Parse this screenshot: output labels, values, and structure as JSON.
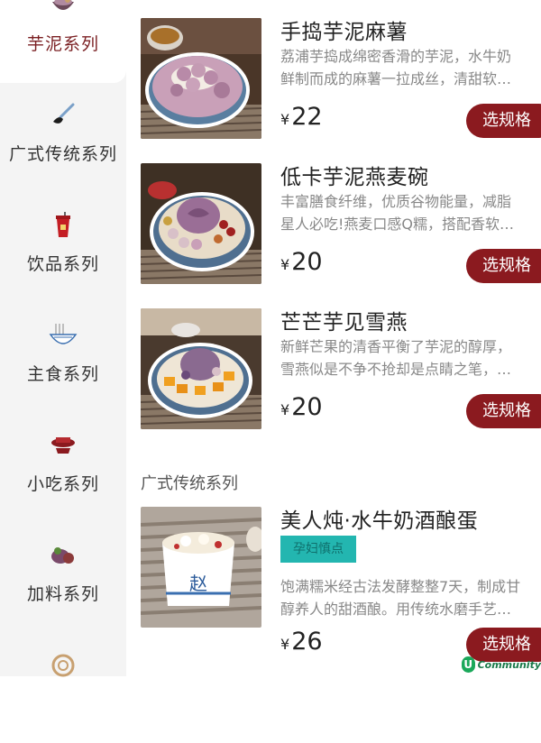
{
  "sidebar": {
    "items": [
      {
        "label": "芋泥系列",
        "icon": "taro-bowl-icon",
        "active": true
      },
      {
        "label": "广式传统系列",
        "icon": "spoon-icon",
        "active": false
      },
      {
        "label": "饮品系列",
        "icon": "drink-cup-icon",
        "active": false
      },
      {
        "label": "主食系列",
        "icon": "noodle-bowl-icon",
        "active": false
      },
      {
        "label": "小吃系列",
        "icon": "snack-dish-icon",
        "active": false
      },
      {
        "label": "加料系列",
        "icon": "topping-icon",
        "active": false
      },
      {
        "label": "",
        "icon": "pastry-icon",
        "active": false
      }
    ]
  },
  "sections": [
    {
      "title": "",
      "products": [
        {
          "name": "手捣芋泥麻薯",
          "desc_line1": "荔浦芋捣成绵密香滑的芋泥，水牛奶",
          "desc_line2": "鲜制而成的麻薯一拉成丝，清甜软…",
          "currency": "¥",
          "price": "22",
          "button": "选规格",
          "image": "taro-mochi-photo"
        },
        {
          "name": "低卡芋泥燕麦碗",
          "desc_line1": "丰富膳食纤维，优质谷物能量，减脂",
          "desc_line2": "星人必吃!燕麦口感Q糯，搭配香软…",
          "currency": "¥",
          "price": "20",
          "button": "选规格",
          "image": "taro-oat-bowl-photo"
        },
        {
          "name": "芒芒芋见雪燕",
          "desc_line1": "新鲜芒果的清香平衡了芋泥的醇厚，",
          "desc_line2": "雪燕似是不争不抢却是点睛之笔，…",
          "currency": "¥",
          "price": "20",
          "button": "选规格",
          "image": "mango-taro-photo"
        }
      ]
    },
    {
      "title": "广式传统系列",
      "products": [
        {
          "name": "美人炖·水牛奶酒酿蛋",
          "badge": "孕妇慎点",
          "desc_line1": "饱满糯米经古法发酵整整7天，制成甘",
          "desc_line2": "醇养人的甜酒酿。用传统水磨手艺…",
          "currency": "¥",
          "price": "26",
          "button": "选规格",
          "image": "rice-wine-egg-photo",
          "cup_text": "赵"
        }
      ]
    }
  ],
  "watermark": {
    "logo": "U",
    "text": "Community"
  }
}
